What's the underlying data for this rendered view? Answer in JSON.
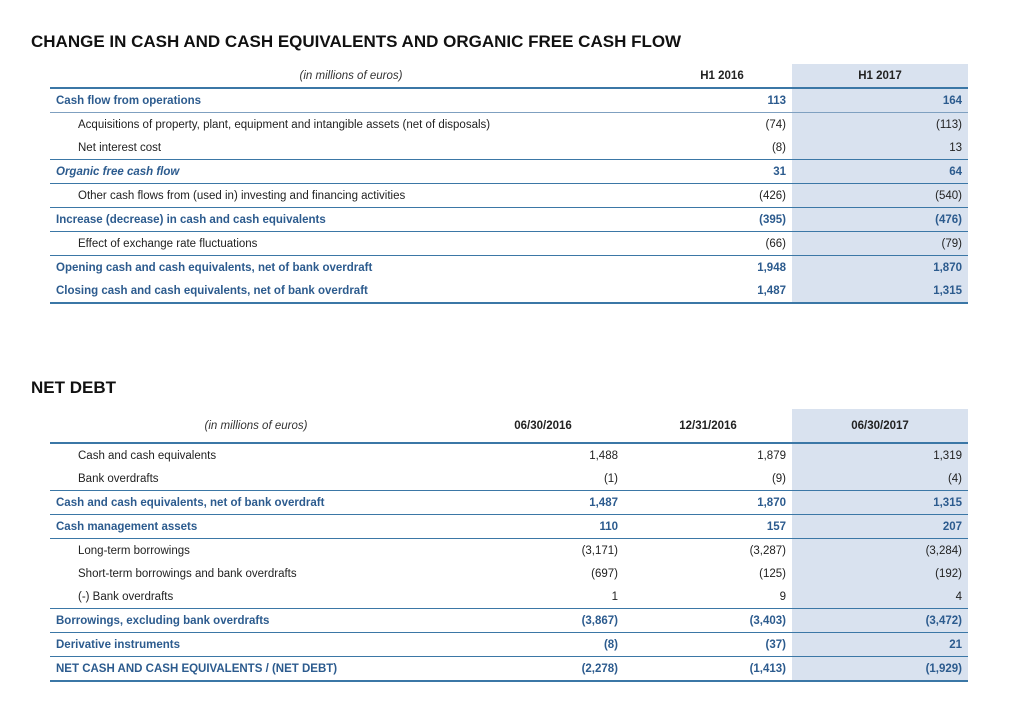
{
  "cashflow": {
    "title": "CHANGE IN CASH AND CASH EQUIVALENTS AND ORGANIC FREE CASH FLOW",
    "unit": "(in millions of euros)",
    "columns": [
      "H1 2016",
      "H1 2017"
    ],
    "rows": [
      {
        "label": "Cash flow from operations",
        "values": [
          "113",
          "164"
        ]
      },
      {
        "label": "Acquisitions of property, plant, equipment and intangible assets (net of disposals)",
        "values": [
          "(74)",
          "(113)"
        ]
      },
      {
        "label": "Net interest cost",
        "values": [
          "(8)",
          "13"
        ]
      },
      {
        "label": "Organic free cash flow",
        "values": [
          "31",
          "64"
        ]
      },
      {
        "label": "Other cash flows from (used in) investing and financing activities",
        "values": [
          "(426)",
          "(540)"
        ]
      },
      {
        "label": "Increase (decrease) in cash and cash equivalents",
        "values": [
          "(395)",
          "(476)"
        ]
      },
      {
        "label": "Effect of exchange rate fluctuations",
        "values": [
          "(66)",
          "(79)"
        ]
      },
      {
        "label": "Opening cash and cash equivalents, net of bank overdraft",
        "values": [
          "1,948",
          "1,870"
        ]
      },
      {
        "label": "Closing cash and cash equivalents, net of bank overdraft",
        "values": [
          "1,487",
          "1,315"
        ]
      }
    ]
  },
  "netdebt": {
    "title": "NET DEBT",
    "unit": "(in millions of euros)",
    "columns": [
      "06/30/2016",
      "12/31/2016",
      "06/30/2017"
    ],
    "rows": [
      {
        "label": "Cash and cash equivalents",
        "values": [
          "1,488",
          "1,879",
          "1,319"
        ]
      },
      {
        "label": "Bank overdrafts",
        "values": [
          "(1)",
          "(9)",
          "(4)"
        ]
      },
      {
        "label": "Cash and cash equivalents, net of bank overdraft",
        "values": [
          "1,487",
          "1,870",
          "1,315"
        ]
      },
      {
        "label": "Cash management assets",
        "values": [
          "110",
          "157",
          "207"
        ]
      },
      {
        "label": "Long-term borrowings",
        "values": [
          "(3,171)",
          "(3,287)",
          "(3,284)"
        ]
      },
      {
        "label": "Short-term borrowings and bank overdrafts",
        "values": [
          "(697)",
          "(125)",
          "(192)"
        ]
      },
      {
        "label": "(-) Bank overdrafts",
        "values": [
          "1",
          "9",
          "4"
        ]
      },
      {
        "label": "Borrowings, excluding bank overdrafts",
        "values": [
          "(3,867)",
          "(3,403)",
          "(3,472)"
        ]
      },
      {
        "label": "Derivative instruments",
        "values": [
          "(8)",
          "(37)",
          "21"
        ]
      },
      {
        "label": "NET CASH AND CASH EQUIVALENTS / (NET DEBT)",
        "values": [
          "(2,278)",
          "(1,413)",
          "(1,929)"
        ]
      }
    ]
  }
}
